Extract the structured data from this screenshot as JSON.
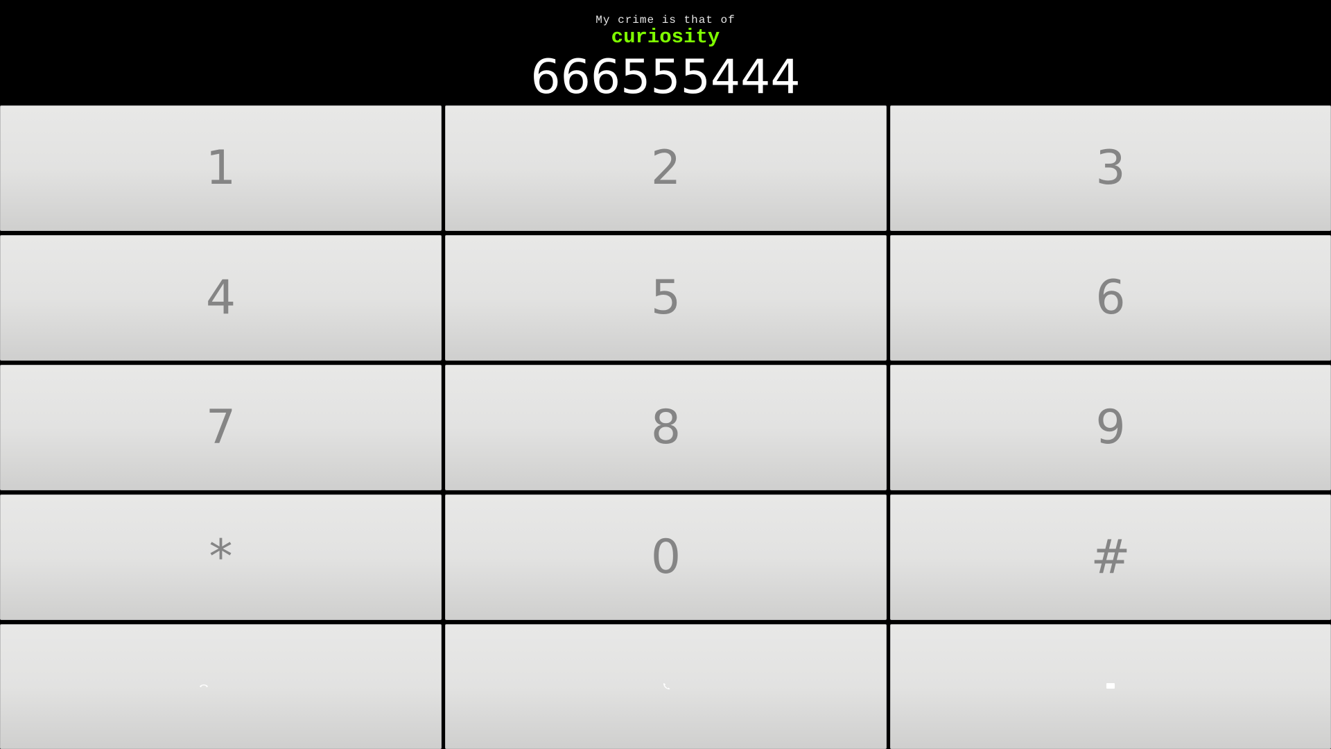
{
  "header": {
    "subtitle": "My crime is that of",
    "title": "curiosity",
    "dialed_number": "666555444",
    "title_color": "#7fff00"
  },
  "keypad": {
    "keys": [
      "1",
      "2",
      "3",
      "4",
      "5",
      "6",
      "7",
      "8",
      "9",
      "*",
      "0",
      "#"
    ],
    "actions": [
      {
        "icon": "hangup-icon"
      },
      {
        "icon": "phone-icon"
      },
      {
        "icon": "message-icon"
      }
    ]
  }
}
